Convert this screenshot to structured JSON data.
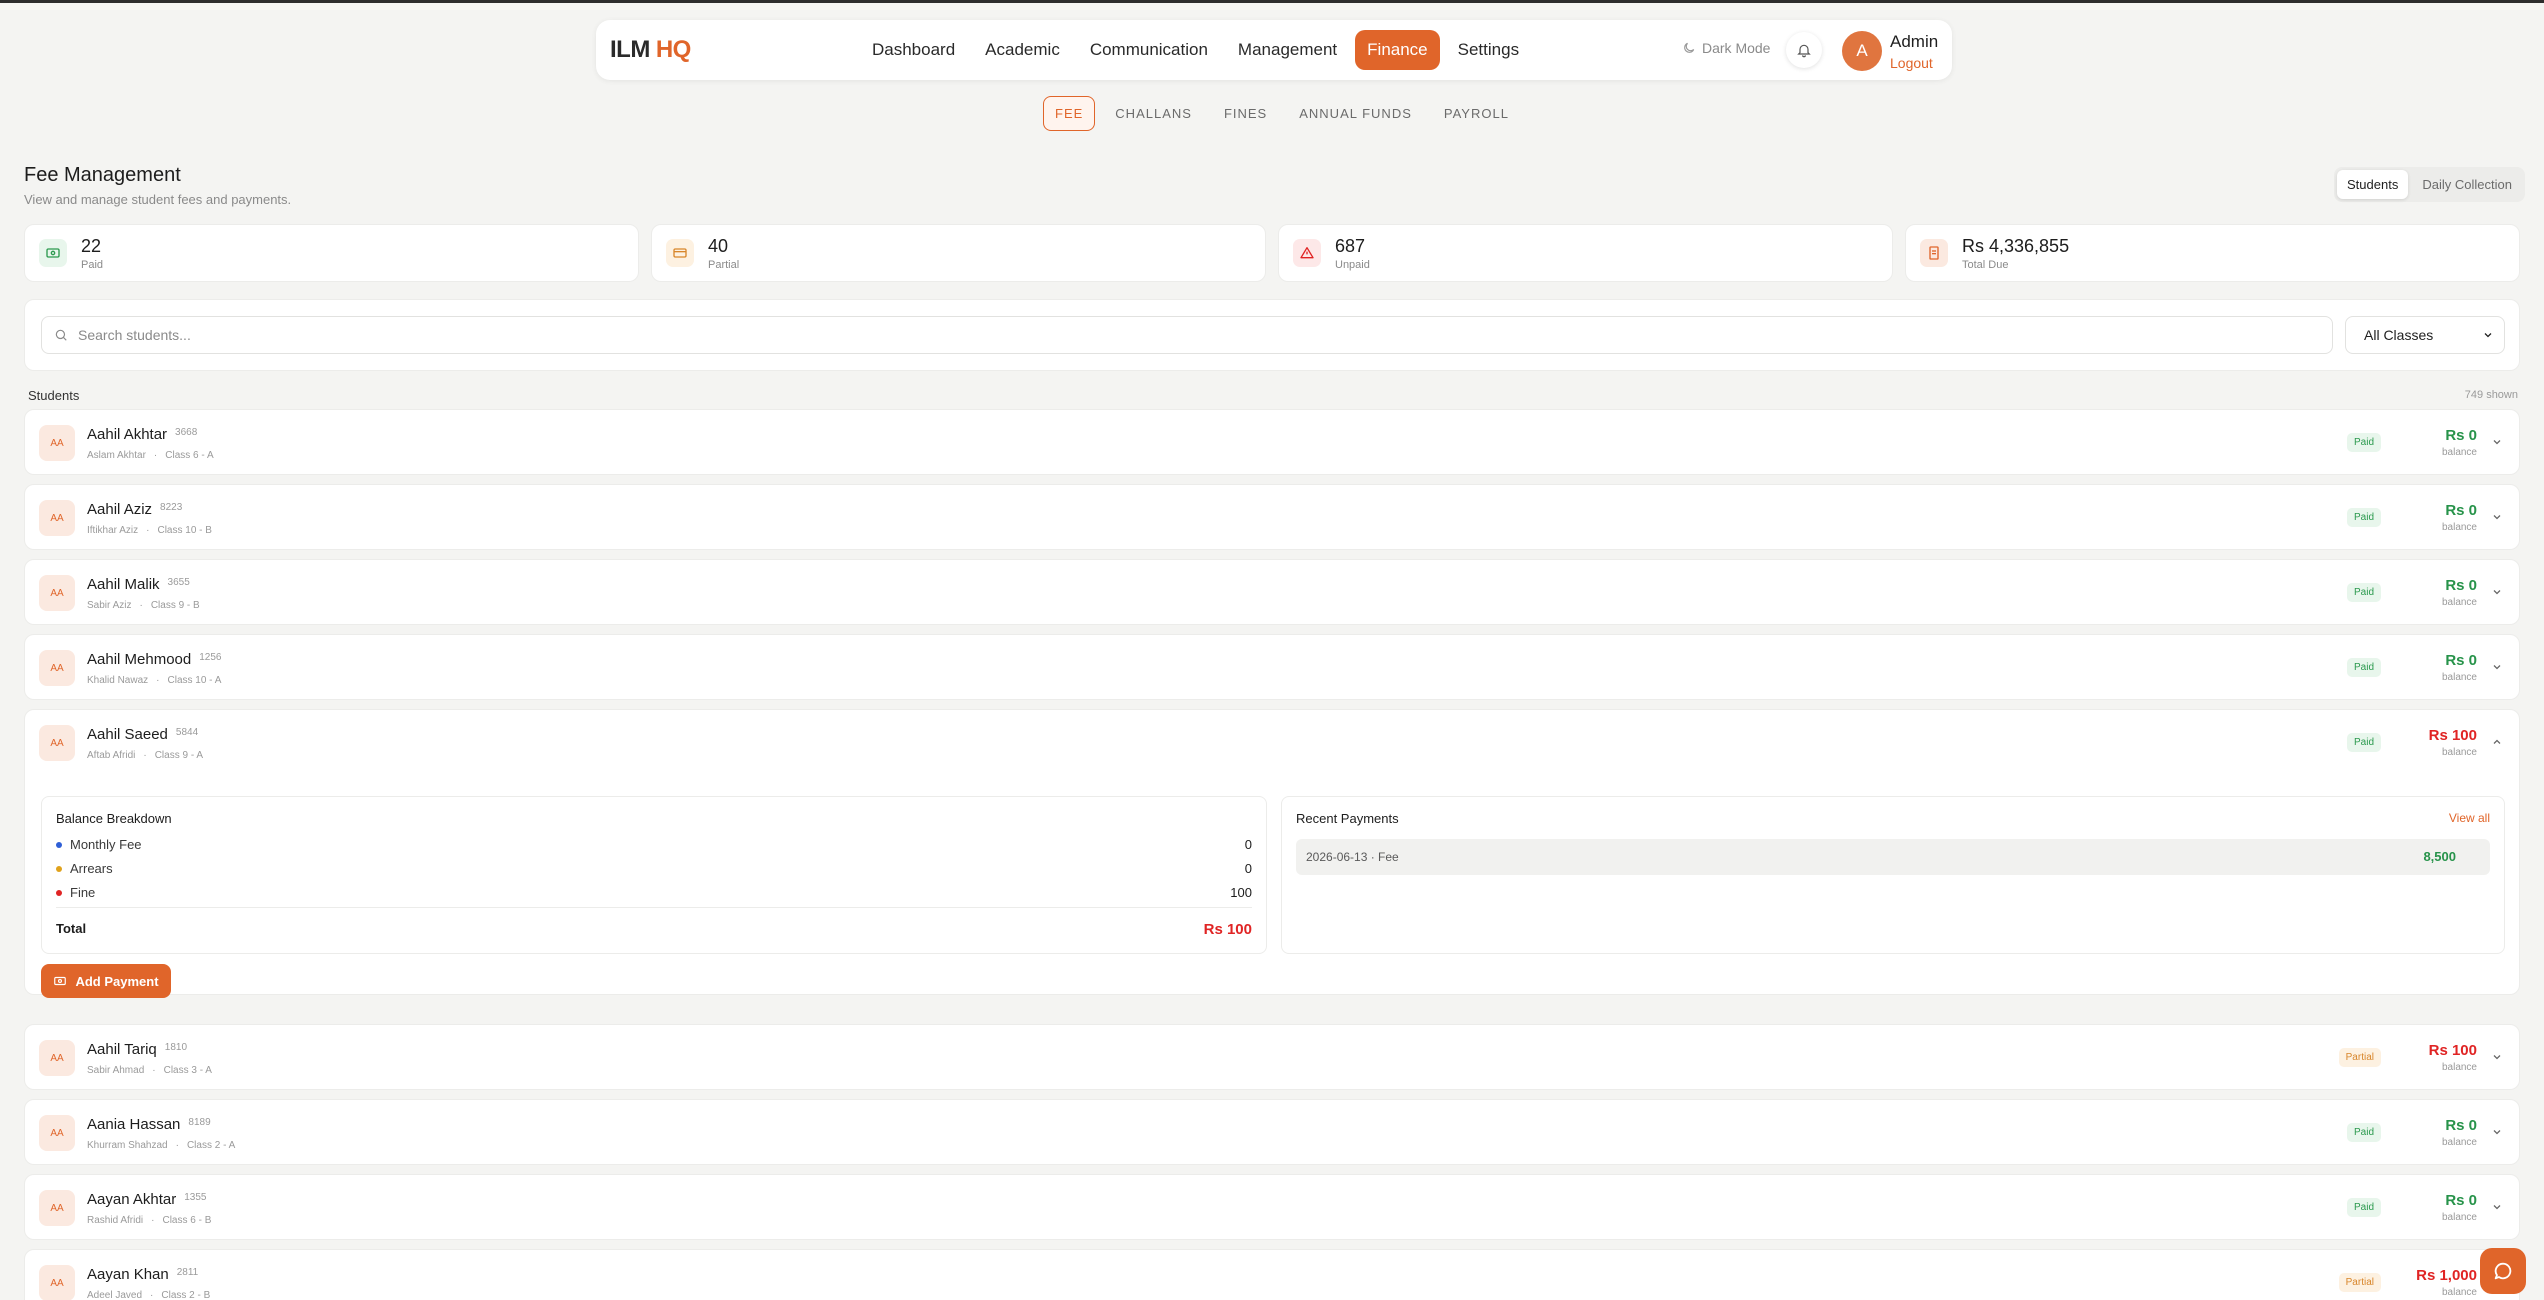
{
  "brand": {
    "part1": "ILM",
    "part2": "HQ"
  },
  "nav": {
    "items": [
      "Dashboard",
      "Academic",
      "Communication",
      "Management",
      "Finance",
      "Settings"
    ],
    "active": "Finance",
    "dark_mode_label": "Dark Mode"
  },
  "user": {
    "initial": "A",
    "name": "Admin",
    "logout_label": "Logout"
  },
  "subtabs": {
    "items": [
      "FEE",
      "CHALLANS",
      "FINES",
      "ANNUAL FUNDS",
      "PAYROLL"
    ],
    "active": "FEE"
  },
  "page": {
    "title": "Fee Management",
    "subtitle": "View and manage student fees and payments.",
    "view_toggle": [
      "Students",
      "Daily Collection"
    ],
    "view_active": "Students"
  },
  "stats": [
    {
      "value": "22",
      "label": "Paid",
      "color": "#2b9a4e",
      "bg": "#e8f6ec",
      "icon": "cash-icon"
    },
    {
      "value": "40",
      "label": "Partial",
      "color": "#d8862b",
      "bg": "#fdf1e1",
      "icon": "card-icon"
    },
    {
      "value": "687",
      "label": "Unpaid",
      "color": "#e02424",
      "bg": "#fde8e8",
      "icon": "alert-triangle-icon"
    },
    {
      "value": "Rs 4,336,855",
      "label": "Total Due",
      "color": "#e0652a",
      "bg": "#fbe9e0",
      "icon": "receipt-icon"
    }
  ],
  "search": {
    "placeholder": "Search students...",
    "class_filter": "All Classes"
  },
  "list": {
    "heading": "Students",
    "count": "749 shown"
  },
  "students": [
    {
      "initials": "AA",
      "name": "Aahil Akhtar",
      "id": "3668",
      "parent": "Aslam Akhtar",
      "class": "Class 6 - A",
      "status": "Paid",
      "balance": "Rs 0",
      "balance_label": "balance"
    },
    {
      "initials": "AA",
      "name": "Aahil Aziz",
      "id": "8223",
      "parent": "Iftikhar Aziz",
      "class": "Class 10 - B",
      "status": "Paid",
      "balance": "Rs 0",
      "balance_label": "balance"
    },
    {
      "initials": "AA",
      "name": "Aahil Malik",
      "id": "3655",
      "parent": "Sabir Aziz",
      "class": "Class 9 - B",
      "status": "Paid",
      "balance": "Rs 0",
      "balance_label": "balance"
    },
    {
      "initials": "AA",
      "name": "Aahil Mehmood",
      "id": "1256",
      "parent": "Khalid Nawaz",
      "class": "Class 10 - A",
      "status": "Paid",
      "balance": "Rs 0",
      "balance_label": "balance"
    },
    {
      "initials": "AA",
      "name": "Aahil Saeed",
      "id": "5844",
      "parent": "Aftab Afridi",
      "class": "Class 9 - A",
      "status": "Paid",
      "balance": "Rs 100",
      "balance_label": "balance"
    },
    {
      "initials": "AA",
      "name": "Aahil Tariq",
      "id": "1810",
      "parent": "Sabir Ahmad",
      "class": "Class 3 - A",
      "status": "Partial",
      "balance": "Rs 100",
      "balance_label": "balance"
    },
    {
      "initials": "AA",
      "name": "Aania Hassan",
      "id": "8189",
      "parent": "Khurram Shahzad",
      "class": "Class 2 - A",
      "status": "Paid",
      "balance": "Rs 0",
      "balance_label": "balance"
    },
    {
      "initials": "AA",
      "name": "Aayan Akhtar",
      "id": "1355",
      "parent": "Rashid Afridi",
      "class": "Class 6 - B",
      "status": "Paid",
      "balance": "Rs 0",
      "balance_label": "balance"
    },
    {
      "initials": "AA",
      "name": "Aayan Khan",
      "id": "2811",
      "parent": "Adeel Javed",
      "class": "Class 2 - B",
      "status": "Partial",
      "balance": "Rs 1,000",
      "balance_label": "balance"
    }
  ],
  "expanded": {
    "breakdown_title": "Balance Breakdown",
    "breakdown": [
      {
        "label": "Monthly Fee",
        "value": "0",
        "color": "#2f5fd6"
      },
      {
        "label": "Arrears",
        "value": "0",
        "color": "#e0a21c"
      },
      {
        "label": "Fine",
        "value": "100",
        "color": "#e02424"
      }
    ],
    "total_label": "Total",
    "total_value": "Rs 100",
    "recent_title": "Recent Payments",
    "view_all": "View all",
    "payments": [
      {
        "desc": "2026-06-13 · Fee",
        "amount": "8,500"
      }
    ],
    "add_payment": "Add Payment"
  }
}
